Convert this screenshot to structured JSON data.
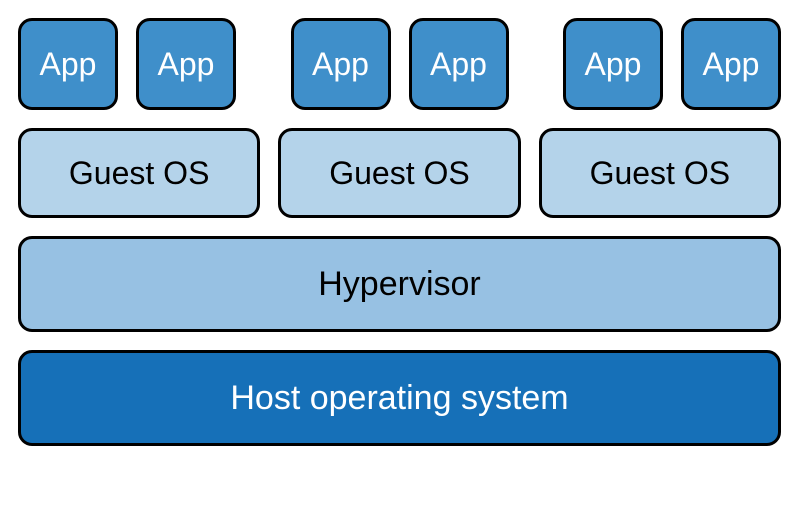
{
  "apps": {
    "groups": [
      {
        "labels": [
          "App",
          "App"
        ]
      },
      {
        "labels": [
          "App",
          "App"
        ]
      },
      {
        "labels": [
          "App",
          "App"
        ]
      }
    ]
  },
  "guests": {
    "labels": [
      "Guest OS",
      "Guest OS",
      "Guest OS"
    ]
  },
  "hypervisor": {
    "label": "Hypervisor"
  },
  "host": {
    "label": "Host operating system"
  }
}
